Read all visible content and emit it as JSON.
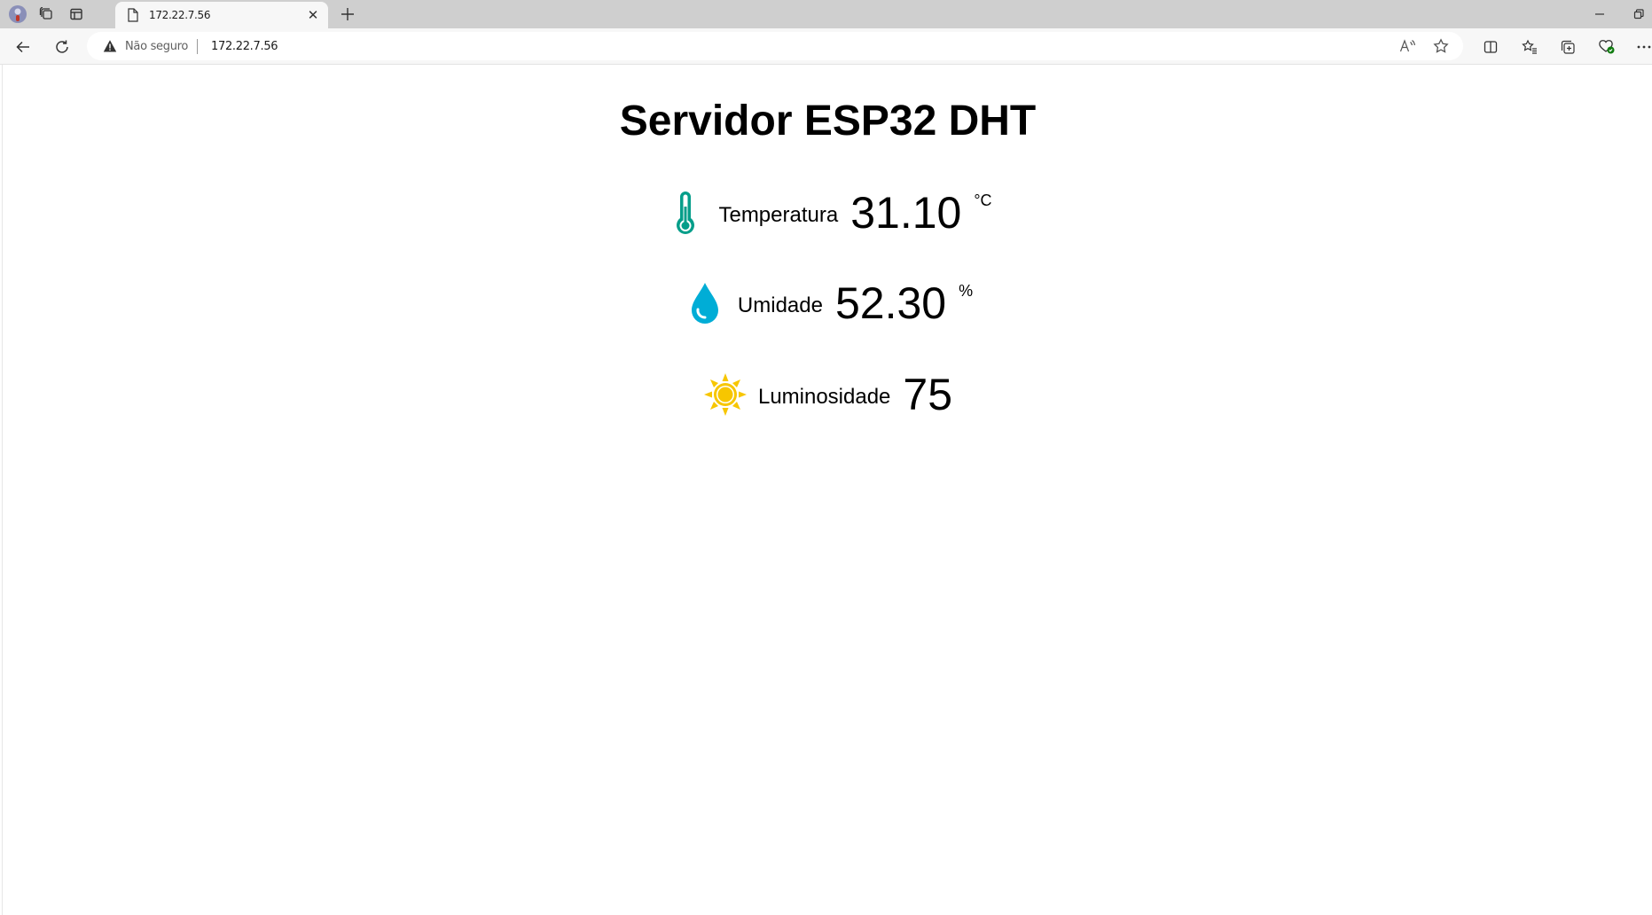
{
  "browser": {
    "tab": {
      "title": "172.22.7.56"
    },
    "address_bar": {
      "security_label": "Não seguro",
      "url": "172.22.7.56"
    },
    "colors": {
      "tabstrip_bg": "#cfcfcf",
      "toolbar_bg": "#f7f7f7",
      "warning": "#333333"
    }
  },
  "page": {
    "title": "Servidor ESP32 DHT",
    "readings": [
      {
        "label": "Temperatura",
        "value": "31.10",
        "unit": "°C",
        "icon": "thermometer-icon",
        "color": "#059e8a"
      },
      {
        "label": "Umidade",
        "value": "52.30",
        "unit": "%",
        "icon": "water-drop-icon",
        "color": "#00add6"
      },
      {
        "label": "Luminosidade",
        "value": "75",
        "unit": "",
        "icon": "sun-icon",
        "color": "#f7c600"
      }
    ]
  }
}
